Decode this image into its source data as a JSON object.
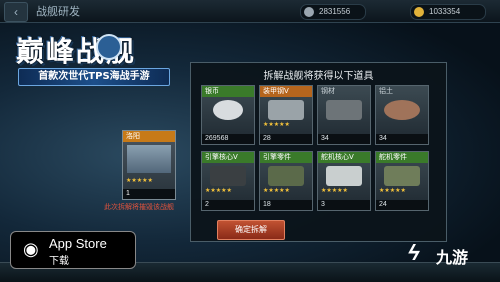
{
  "header": {
    "title": "战舰研发",
    "resources": [
      "2831556",
      "1033354"
    ]
  },
  "logo": {
    "main": "巅峰战舰",
    "subtitle": "首款次世代TPS海战手游"
  },
  "ship": {
    "name": "洛阳",
    "stars": "★★★★★",
    "count": "1",
    "warning": "此次拆解将摧毁该战舰"
  },
  "dialog": {
    "title": "拆解战舰将获得以下道具",
    "items": [
      {
        "name": "银币",
        "count": "269568",
        "stars": "",
        "tier": "green",
        "color": "#d8dcdf"
      },
      {
        "name": "装甲钢V",
        "count": "28",
        "stars": "★★★★★",
        "tier": "orange",
        "color": "#9aa3a8"
      },
      {
        "name": "钢材",
        "count": "34",
        "stars": "",
        "tier": "gray",
        "color": "#6d7478"
      },
      {
        "name": "铝土",
        "count": "34",
        "stars": "",
        "tier": "gray",
        "color": "#a0735a"
      },
      {
        "name": "引擎核心V",
        "count": "2",
        "stars": "★★★★★",
        "tier": "green",
        "color": "#3a3f42"
      },
      {
        "name": "引擎零件",
        "count": "18",
        "stars": "★★★★★",
        "tier": "green",
        "color": "#5b6a4a"
      },
      {
        "name": "舵机核心V",
        "count": "3",
        "stars": "★★★★★",
        "tier": "green",
        "color": "#c9cfcf"
      },
      {
        "name": "舵机零件",
        "count": "24",
        "stars": "★★★★★",
        "tier": "green",
        "color": "#6f7d5a"
      }
    ],
    "confirm_label": "确定拆解"
  },
  "appstore": {
    "label": "App Store",
    "sublabel": "下载"
  },
  "watermark": {
    "text": "九游"
  }
}
